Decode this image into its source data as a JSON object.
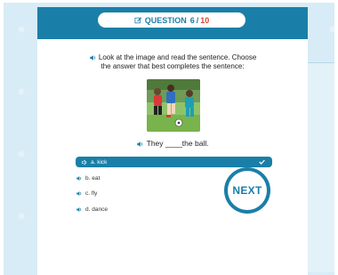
{
  "header": {
    "title_label": "QUESTION",
    "current": "6",
    "separator": "/",
    "total": "10",
    "icon": "edit-icon"
  },
  "prompt": {
    "line1": "Look at the image and read the sentence. Choose",
    "line2": "the answer that best completes the sentence:",
    "icon": "speaker-icon"
  },
  "image": {
    "description_icon": "soccer-photo"
  },
  "sentence": {
    "text": "They ____the ball.",
    "icon": "speaker-icon"
  },
  "options": [
    {
      "label": "a. kick",
      "selected": true
    },
    {
      "label": "b. eat",
      "selected": false
    },
    {
      "label": "c. fly",
      "selected": false
    },
    {
      "label": "d. dance",
      "selected": false
    }
  ],
  "next_button": {
    "label": "NEXT"
  },
  "colors": {
    "accent": "#1a7fa8",
    "total_number": "#e0452a",
    "background": "#d7ecf6"
  }
}
